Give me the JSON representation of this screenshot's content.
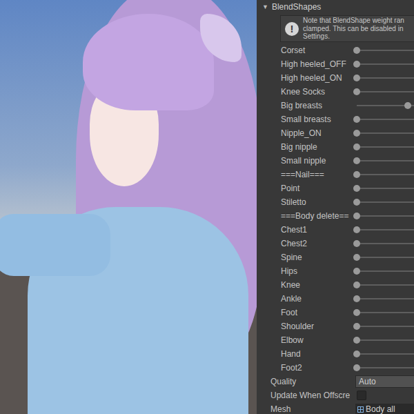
{
  "panel": {
    "title": "BlendShapes",
    "expanded": true,
    "toggle_icon": "▼"
  },
  "notice": {
    "icon": "!",
    "lines": [
      "Note that BlendShape weight ran",
      "clamped. This can be disabled in",
      "Settings."
    ]
  },
  "blendshapes": [
    {
      "label": "Corset",
      "level": 0
    },
    {
      "label": "High heeled_OFF",
      "level": 0
    },
    {
      "label": "High heeled_ON",
      "level": 0
    },
    {
      "label": "Knee Socks",
      "level": 0
    },
    {
      "label": "Big breasts",
      "level": 0.95
    },
    {
      "label": "Small breasts",
      "level": 0
    },
    {
      "label": "Nipple_ON",
      "level": 0
    },
    {
      "label": "Big nipple",
      "level": 0
    },
    {
      "label": "Small nipple",
      "level": 0
    },
    {
      "label": "===Nail===",
      "level": 0
    },
    {
      "label": "Point",
      "level": 0
    },
    {
      "label": "Stiletto",
      "level": 0
    },
    {
      "label": "===Body delete==",
      "level": 0
    },
    {
      "label": "Chest1",
      "level": 0
    },
    {
      "label": "Chest2",
      "level": 0
    },
    {
      "label": "Spine",
      "level": 0
    },
    {
      "label": "Hips",
      "level": 0
    },
    {
      "label": "Knee",
      "level": 0
    },
    {
      "label": "Ankle",
      "level": 0
    },
    {
      "label": "Foot",
      "level": 0
    },
    {
      "label": "Shoulder",
      "level": 0
    },
    {
      "label": "Elbow",
      "level": 0
    },
    {
      "label": "Hand",
      "level": 0
    },
    {
      "label": "Foot2",
      "level": 0
    }
  ],
  "quality": {
    "label": "Quality",
    "value": "Auto"
  },
  "update_offscreen": {
    "label": "Update When Offscre",
    "checked": false
  },
  "mesh": {
    "label": "Mesh",
    "value": "Body all"
  }
}
